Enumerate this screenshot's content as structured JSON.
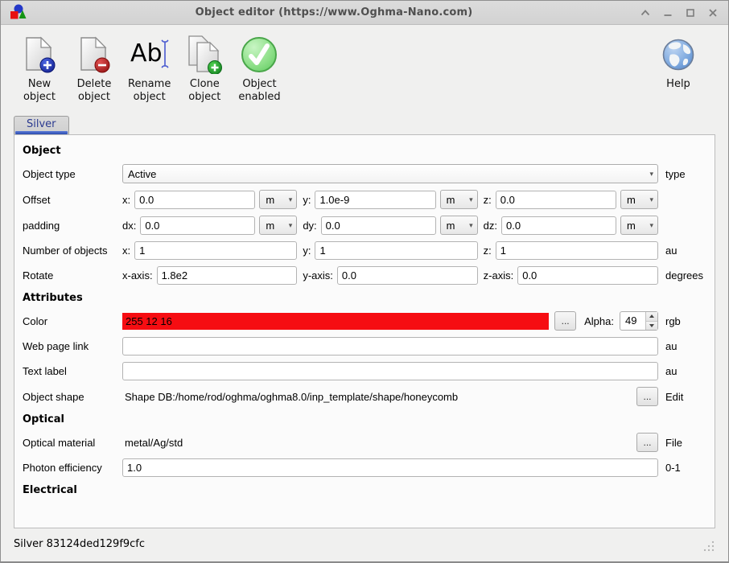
{
  "window": {
    "title": "Object editor (https://www.Oghma-Nano.com)"
  },
  "toolbar": {
    "buttons": [
      {
        "label": "New\nobject"
      },
      {
        "label": "Delete\nobject"
      },
      {
        "label": "Rename\nobject"
      },
      {
        "label": "Clone\nobject"
      },
      {
        "label": "Object\nenabled"
      }
    ],
    "help_label": "Help"
  },
  "tabs": [
    {
      "label": "Silver",
      "active": true
    }
  ],
  "form": {
    "sections": {
      "object": "Object",
      "attributes": "Attributes",
      "optical": "Optical",
      "electrical": "Electrical"
    },
    "object_type": {
      "label": "Object type",
      "value": "Active",
      "unit": "type"
    },
    "offset": {
      "label": "Offset",
      "unit": "",
      "fields": [
        {
          "k": "x:",
          "v": "0.0",
          "u": "m"
        },
        {
          "k": "y:",
          "v": "1.0e-9",
          "u": "m"
        },
        {
          "k": "z:",
          "v": "0.0",
          "u": "m"
        }
      ]
    },
    "padding": {
      "label": "padding",
      "unit": "",
      "fields": [
        {
          "k": "dx:",
          "v": "0.0",
          "u": "m"
        },
        {
          "k": "dy:",
          "v": "0.0",
          "u": "m"
        },
        {
          "k": "dz:",
          "v": "0.0",
          "u": "m"
        }
      ]
    },
    "number": {
      "label": "Number of objects",
      "unit": "au",
      "fields": [
        {
          "k": "x:",
          "v": "1"
        },
        {
          "k": "y:",
          "v": "1"
        },
        {
          "k": "z:",
          "v": "1"
        }
      ]
    },
    "rotate": {
      "label": "Rotate",
      "unit": "degrees",
      "fields": [
        {
          "k": "x-axis:",
          "v": "1.8e2"
        },
        {
          "k": "y-axis:",
          "v": "0.0"
        },
        {
          "k": "z-axis:",
          "v": "0.0"
        }
      ]
    },
    "color": {
      "label": "Color",
      "value": "255 12 16",
      "swatch": "#f60d12",
      "browse": "...",
      "alpha_label": "Alpha:",
      "alpha": "49",
      "unit": "rgb"
    },
    "web_link": {
      "label": "Web page link",
      "value": "",
      "unit": "au"
    },
    "text_label": {
      "label": "Text label",
      "value": "",
      "unit": "au"
    },
    "object_shape": {
      "label": "Object shape",
      "value": "Shape DB:/home/rod/oghma/oghma8.0/inp_template/shape/honeycomb",
      "browse": "...",
      "unit": "Edit"
    },
    "optical_material": {
      "label": "Optical material",
      "value": "metal/Ag/std",
      "browse": "...",
      "unit": "File"
    },
    "photon_eff": {
      "label": "Photon efficiency",
      "value": "1.0",
      "unit": "0-1"
    }
  },
  "statusbar": {
    "text": "Silver 83124ded129f9cfc"
  }
}
